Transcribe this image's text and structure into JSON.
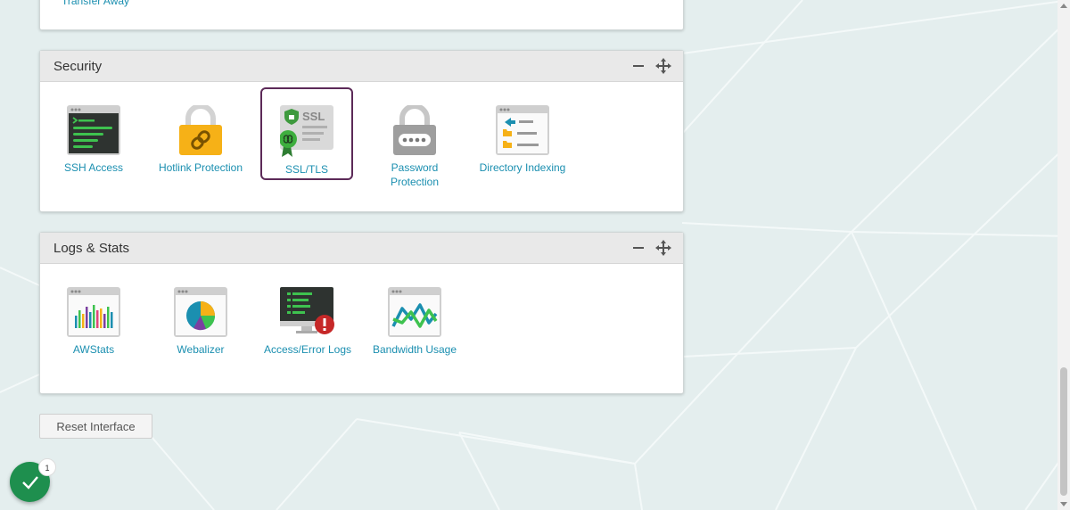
{
  "top_panel": {
    "link": "Transfer Away"
  },
  "security": {
    "title": "Security",
    "items": [
      {
        "label": "SSH Access",
        "icon": "ssh-terminal-icon"
      },
      {
        "label": "Hotlink Protection",
        "icon": "padlock-link-icon"
      },
      {
        "label": "SSL/TLS",
        "icon": "ssl-certificate-icon",
        "selected": true
      },
      {
        "label": "Password Protection",
        "icon": "password-lock-icon"
      },
      {
        "label": "Directory Indexing",
        "icon": "directory-index-icon"
      }
    ]
  },
  "logs": {
    "title": "Logs & Stats",
    "items": [
      {
        "label": "AWStats",
        "icon": "awstats-bar-chart-icon"
      },
      {
        "label": "Webalizer",
        "icon": "webalizer-pie-chart-icon"
      },
      {
        "label": "Access/Error Logs",
        "icon": "error-log-monitor-icon"
      },
      {
        "label": "Bandwidth Usage",
        "icon": "bandwidth-line-chart-icon"
      }
    ]
  },
  "reset_label": "Reset Interface",
  "notification_count": "1",
  "colors": {
    "link": "#1b8fb0",
    "selected_border": "#5c2a58",
    "fab": "#1e8f4e"
  }
}
